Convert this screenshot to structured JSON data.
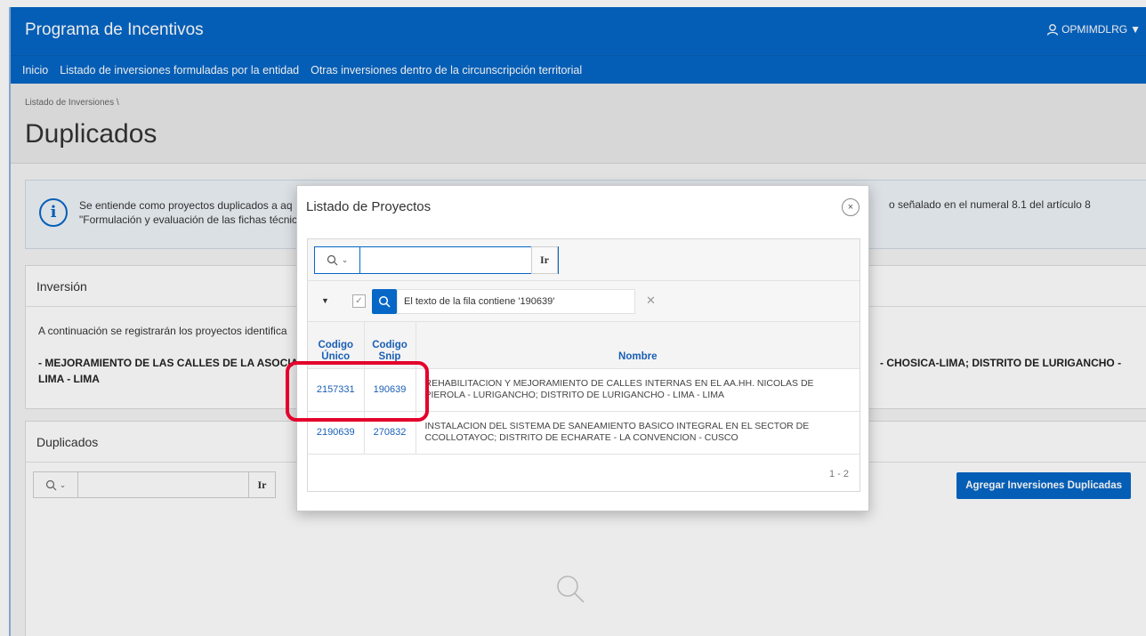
{
  "header": {
    "app_title": "Programa de Incentivos",
    "user": "OPMIMDLRG",
    "nav": [
      "Inicio",
      "Listado de inversiones formuladas por la entidad",
      "Otras inversiones dentro de la circunscripción territorial"
    ]
  },
  "breadcrumb": "Listado de Inversiones",
  "page_title": "Duplicados",
  "info": {
    "line1": "Se entiende como proyectos duplicados a aq",
    "line2": "\"Formulación y evaluación de las fichas técnic",
    "right": "o señalado en el numeral 8.1 del artículo 8"
  },
  "inversion": {
    "heading": "Inversión",
    "p1": "A continuación se registrarán los proyectos identifica",
    "p2": "- MEJORAMIENTO DE LAS CALLES DE LA ASOCIAC",
    "p2_right": "- CHOSICA-LIMA; DISTRITO DE LURIGANCHO -",
    "p3": "LIMA - LIMA"
  },
  "duplicados": {
    "heading": "Duplicados",
    "go_label": "Ir",
    "add_button": "Agregar Inversiones Duplicadas"
  },
  "modal": {
    "title": "Listado de Proyectos",
    "close": "×",
    "go_label": "Ir",
    "search_value": "",
    "filter_text": "El texto de la fila contiene '190639'",
    "columns": {
      "codigo_unico": "Codigo Único",
      "codigo_snip": "Codigo Snip",
      "nombre": "Nombre"
    },
    "rows": [
      {
        "codigo_unico": "2157331",
        "codigo_snip": "190639",
        "nombre": "REHABILITACION Y MEJORAMIENTO DE CALLES INTERNAS EN EL AA.HH. NICOLAS DE PIEROLA - LURIGANCHO; DISTRITO DE LURIGANCHO - LIMA - LIMA"
      },
      {
        "codigo_unico": "2190639",
        "codigo_snip": "270832",
        "nombre": "INSTALACION DEL SISTEMA DE SANEAMIENTO BASICO INTEGRAL EN EL SECTOR DE CCOLLOTAYOC; DISTRITO DE ECHARATE - LA CONVENCION - CUSCO"
      }
    ],
    "pagination": "1 - 2"
  },
  "colors": {
    "brand": "#0667c6",
    "highlight": "#e4002b",
    "link": "#1a5fb4"
  }
}
